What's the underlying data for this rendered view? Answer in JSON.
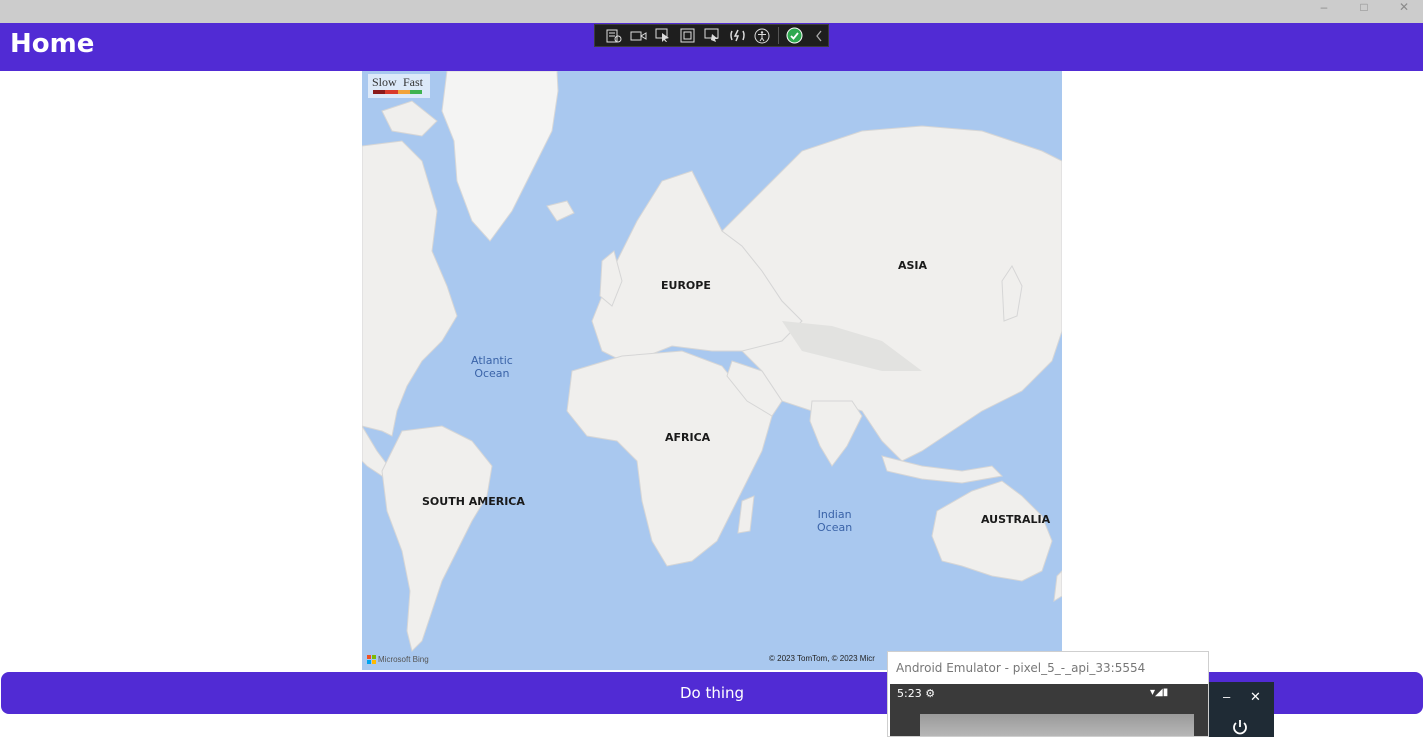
{
  "window": {
    "minimize_glyph": "–",
    "maximize_glyph": "□",
    "close_glyph": "✕"
  },
  "header": {
    "title": "Home"
  },
  "devtools": {
    "tools": [
      "live-visual-tree-icon",
      "record-icon",
      "select-element-icon",
      "display-layout-adorners-icon",
      "track-focus-icon",
      "hot-reload-icon",
      "accessibility-icon",
      "checkmark-icon",
      "collapse-chevron-icon"
    ]
  },
  "map": {
    "legend": {
      "slow": "Slow",
      "fast": "Fast",
      "colors": [
        "#8b1a1a",
        "#d93a2b",
        "#f2a33a",
        "#3fb34f"
      ]
    },
    "continents": {
      "europe": "EUROPE",
      "asia": "ASIA",
      "africa": "AFRICA",
      "south_america": "SOUTH AMERICA",
      "australia": "AUSTRALIA"
    },
    "oceans": {
      "atlantic_line1": "Atlantic",
      "atlantic_line2": "Ocean",
      "indian_line1": "Indian",
      "indian_line2": "Ocean"
    },
    "attribution_brand": "Microsoft Bing",
    "copyright": "© 2023 TomTom, © 2023 Micr",
    "colors": {
      "water": "#a9c8ef",
      "land": "#f0efed"
    }
  },
  "button": {
    "label": "Do thing"
  },
  "emulator": {
    "title": "Android Emulator - pixel_5_-_api_33:5554",
    "time": "5:23",
    "minimize_glyph": "–",
    "close_glyph": "✕"
  },
  "colors": {
    "accent": "#512bd4"
  }
}
